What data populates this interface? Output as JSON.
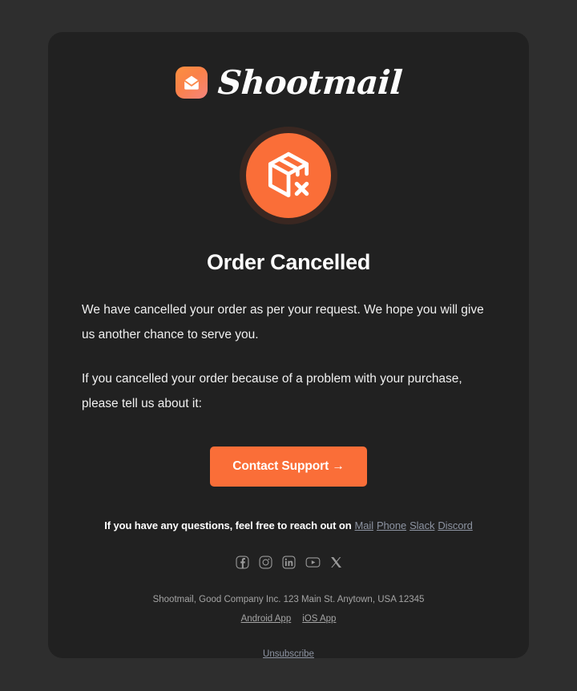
{
  "theme": {
    "page_bg": "#2e2e2e",
    "card_bg": "#212121",
    "accent": "#FA6E38",
    "accent_ring": "#3a2721",
    "link_color": "#8d94a2",
    "muted_text": "#a4a4a4"
  },
  "brand": {
    "name": "Shootmail",
    "mark_icon": "envelope-icon"
  },
  "status": {
    "icon": "package-cancelled-icon",
    "heading": "Order Cancelled"
  },
  "body": {
    "paragraph_1": "We have cancelled your order as per your request. We hope you will give us another chance to serve you.",
    "paragraph_2": "If you cancelled your order because of a problem with your purchase, please tell us about it:"
  },
  "cta": {
    "label": "Contact Support →"
  },
  "contact": {
    "prefix": "If you have any questions, feel free to reach out on",
    "channels": [
      {
        "label": "Mail",
        "icon": "mail-link"
      },
      {
        "label": "Phone",
        "icon": "phone-link"
      },
      {
        "label": "Slack",
        "icon": "slack-link"
      },
      {
        "label": "Discord",
        "icon": "discord-link"
      }
    ]
  },
  "socials": [
    {
      "name": "facebook-icon"
    },
    {
      "name": "instagram-icon"
    },
    {
      "name": "linkedin-icon"
    },
    {
      "name": "youtube-icon"
    },
    {
      "name": "x-twitter-icon"
    }
  ],
  "footer": {
    "address": "Shootmail, Good Company Inc. 123 Main St. Anytown, USA 12345",
    "apps": [
      {
        "label": "Android App"
      },
      {
        "label": "iOS App"
      }
    ],
    "unsubscribe": "Unsubscribe"
  }
}
